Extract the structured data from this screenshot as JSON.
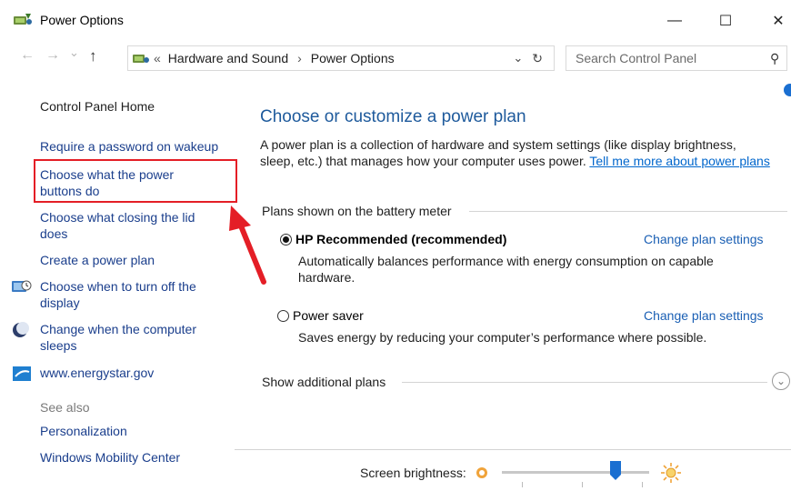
{
  "window": {
    "title": "Power Options",
    "minimize": "—",
    "maximize": "☐",
    "close": "✕"
  },
  "nav": {
    "back": "←",
    "forward": "→",
    "dropdown": "⌄",
    "up": "↑",
    "breadcrumb_sep": "«",
    "crumb1": "Hardware and Sound",
    "crumb_arrow": "›",
    "crumb2": "Power Options",
    "addr_dropdown": "⌄",
    "refresh": "↻",
    "search_placeholder": "Search Control Panel",
    "search_icon": "⚲"
  },
  "sidebar": {
    "home": "Control Panel Home",
    "items": [
      {
        "label": "Require a password on wakeup"
      },
      {
        "label_line1": "Choose what the power",
        "label_line2": "buttons do"
      },
      {
        "label_line1": "Choose what closing the lid",
        "label_line2": "does"
      },
      {
        "label": "Create a power plan"
      },
      {
        "label_line1": "Choose when to turn off the",
        "label_line2": "display"
      },
      {
        "label_line1": "Change when the computer",
        "label_line2": "sleeps"
      },
      {
        "label": "www.energystar.gov"
      }
    ],
    "see_also": "See also",
    "see_also_items": [
      "Personalization",
      "Windows Mobility Center"
    ]
  },
  "main": {
    "heading": "Choose or customize a power plan",
    "intro": "A power plan is a collection of hardware and system settings (like display brightness, sleep, etc.) that manages how your computer uses power.",
    "intro_link": "Tell me more about power plans",
    "plans_label": "Plans shown on the battery meter",
    "plans": [
      {
        "name": "HP Recommended (recommended)",
        "selected": true,
        "desc": "Automatically balances performance with energy consumption on capable hardware.",
        "change": "Change plan settings"
      },
      {
        "name": "Power saver",
        "selected": false,
        "desc": "Saves energy by reducing your computer’s performance where possible.",
        "change": "Change plan settings"
      }
    ],
    "show_additional": "Show additional plans",
    "expand_icon": "⌄",
    "brightness_label": "Screen brightness:",
    "brightness_level": 0.77
  },
  "colors": {
    "link": "#1a3e8c",
    "heading": "#1e5a9c",
    "annotation": "#e41e26",
    "slider_thumb": "#1a6fd1"
  }
}
